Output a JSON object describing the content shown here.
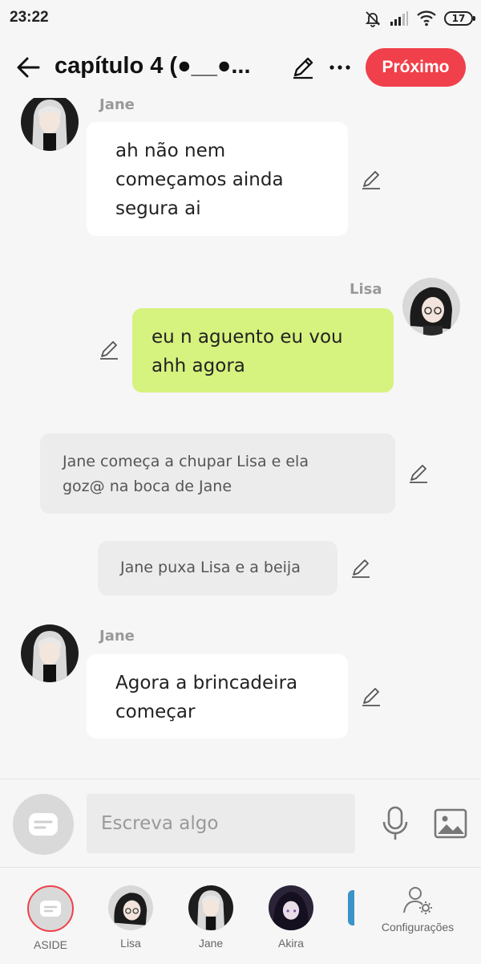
{
  "status_bar": {
    "time": "23:22",
    "battery": "17"
  },
  "header": {
    "title": "capítulo 4  (●__●...",
    "next_label": "Próximo"
  },
  "messages": [
    {
      "sender": "Jane",
      "text_lines": [
        "ah não nem",
        "começamos ainda",
        "segura ai"
      ]
    },
    {
      "sender": "Lisa",
      "text_lines": [
        "eu n aguento eu vou",
        "ahh agora"
      ]
    },
    {
      "narration_lines": [
        "Jane começa a chupar Lisa e ela",
        "goz@ na boca de Jane"
      ]
    },
    {
      "narration_lines": [
        "Jane puxa Lisa e a beija"
      ]
    },
    {
      "sender": "Jane",
      "text_lines": [
        "Agora a brincadeira",
        "começar"
      ]
    }
  ],
  "input": {
    "placeholder": "Escreva algo"
  },
  "bottom_nav": {
    "items": [
      {
        "label": "ASIDE"
      },
      {
        "label": "Lisa"
      },
      {
        "label": "Jane"
      },
      {
        "label": "Akira"
      },
      {
        "label": "Configurações"
      }
    ]
  },
  "colors": {
    "accent": "#f0404b",
    "own_bubble": "#d6f27f",
    "narration_bg": "#ececec"
  }
}
